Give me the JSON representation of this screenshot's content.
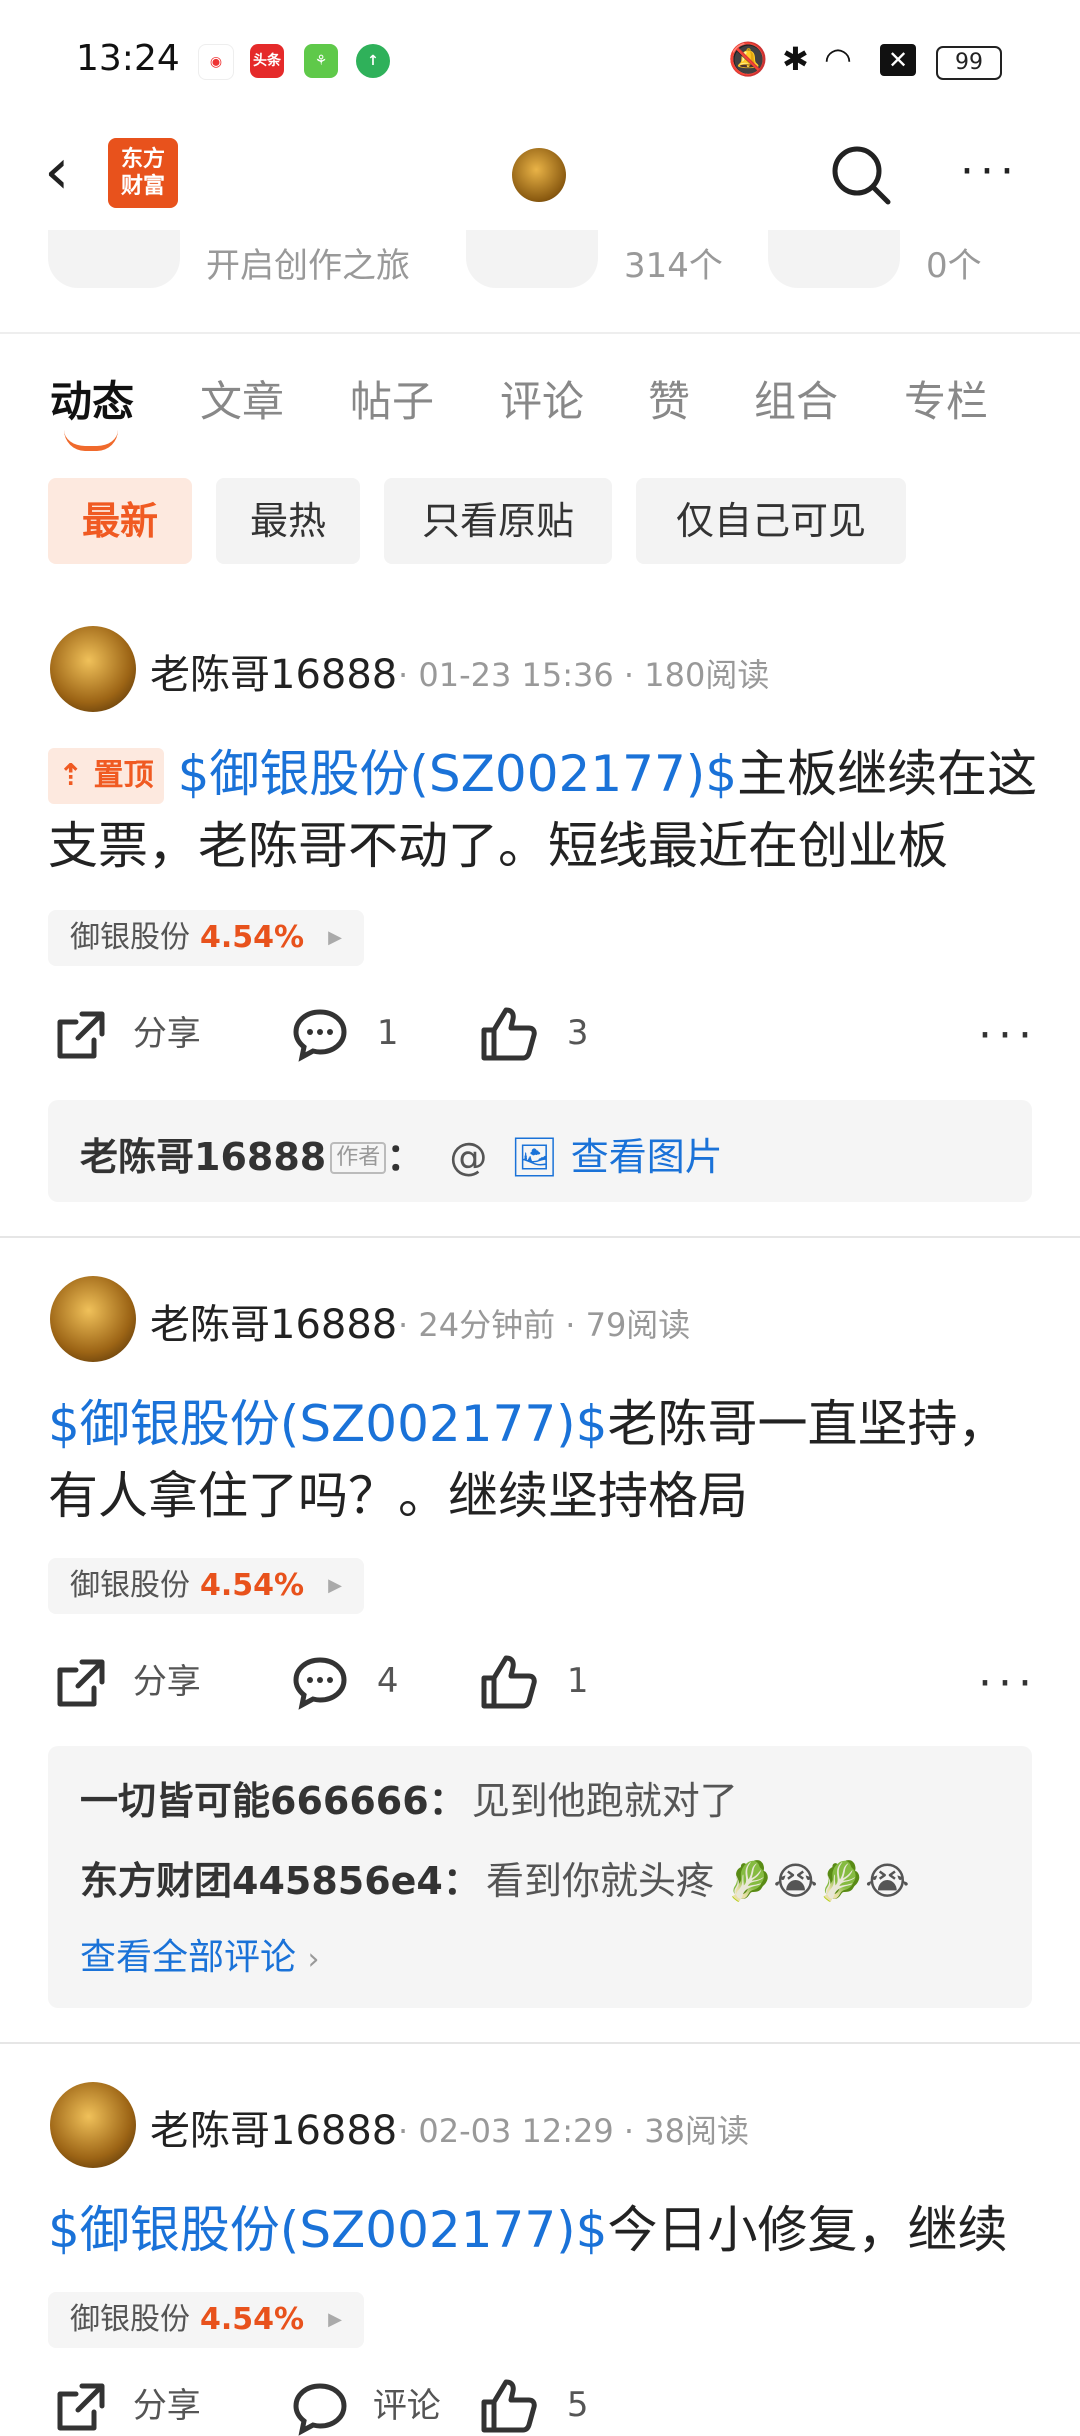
{
  "status_bar": {
    "time": "13:24",
    "battery": "99",
    "apps": [
      "weibo",
      "toutiao",
      "green-app",
      "green-up-app"
    ]
  },
  "header": {
    "logo_line1": "东方",
    "logo_line2": "财富"
  },
  "stats": [
    {
      "label": "开启创作之旅"
    },
    {
      "label": "314个"
    },
    {
      "label": "0个"
    }
  ],
  "tabs": [
    "动态",
    "文章",
    "帖子",
    "评论",
    "赞",
    "组合",
    "专栏"
  ],
  "filters": [
    "最新",
    "最热",
    "只看原贴",
    "仅自己可见"
  ],
  "posts": [
    {
      "user": "老陈哥16888",
      "meta": "· 01-23 15:36 · 180阅读",
      "pin": "置顶",
      "stock_link": "$御银股份(SZ002177)$",
      "text_line1": "主板继续在这",
      "text_line2": "支票，老陈哥不动了。短线最近在创业板",
      "tag_name": "御银股份",
      "tag_pct": "4.54%",
      "share": "分享",
      "comments": "1",
      "likes": "3",
      "comment": {
        "author": "老陈哥16888",
        "author_tag": "作者",
        "sep": "：",
        "at": "@",
        "link": "查看图片"
      }
    },
    {
      "user": "老陈哥16888",
      "meta": "· 24分钟前 · 79阅读",
      "stock_link": "$御银股份(SZ002177)$",
      "text_line1": "老陈哥一直坚持，",
      "text_line2": "有人拿住了吗？。继续坚持格局",
      "tag_name": "御银股份",
      "tag_pct": "4.54%",
      "share": "分享",
      "comments": "4",
      "likes": "1",
      "comments_list": [
        {
          "author": "一切皆可能666666",
          "sep": "：",
          "text": "见到他跑就对了"
        },
        {
          "author": "东方财团445856e4",
          "sep": "：",
          "text": "看到你就头疼 🥬😭🥬😭"
        }
      ],
      "view_all": "查看全部评论"
    },
    {
      "user": "老陈哥16888",
      "meta": "· 02-03 12:29 · 38阅读",
      "stock_link": "$御银股份(SZ002177)$",
      "text_line1": "今日小修复，继续",
      "tag_name": "御银股份",
      "tag_pct": "4.54%",
      "share": "分享",
      "comments_label": "评论",
      "likes": "5"
    }
  ]
}
